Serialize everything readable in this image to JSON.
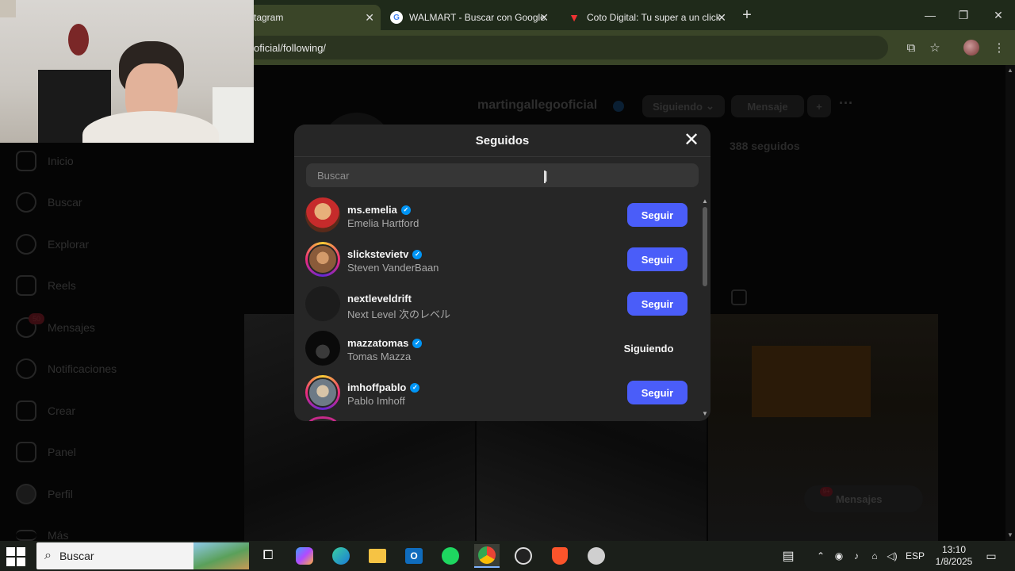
{
  "browser": {
    "tabs": [
      {
        "title": "tagram",
        "active": true,
        "favicon": "instagram-icon"
      },
      {
        "title": "WALMART - Buscar con Google",
        "active": false,
        "favicon": "google-icon"
      },
      {
        "title": "Coto Digital: Tu super a un click",
        "active": false,
        "favicon": "coto-icon"
      }
    ],
    "new_tab": "+",
    "url": "oficial/following/"
  },
  "sidebar": {
    "items": [
      {
        "label": "Inicio",
        "icon": "home-icon"
      },
      {
        "label": "Buscar",
        "icon": "search-icon"
      },
      {
        "label": "Explorar",
        "icon": "compass-icon"
      },
      {
        "label": "Reels",
        "icon": "reels-icon"
      },
      {
        "label": "Mensajes",
        "icon": "messenger-icon",
        "badge": "50"
      },
      {
        "label": "Notificaciones",
        "icon": "heart-icon"
      },
      {
        "label": "Crear",
        "icon": "plus-square-icon"
      },
      {
        "label": "Panel",
        "icon": "chart-icon"
      },
      {
        "label": "Perfil",
        "icon": "profile-icon"
      },
      {
        "label": "Más",
        "icon": "menu-icon"
      }
    ]
  },
  "profile": {
    "username": "martingallegooficial",
    "following_button": "Siguiendo",
    "message_button": "Mensaje",
    "following_count": "388 seguidos",
    "messages_pill": "Mensajes",
    "messages_badge": "9+"
  },
  "modal": {
    "title": "Seguidos",
    "search_placeholder": "Buscar",
    "users": [
      {
        "username": "ms.emelia",
        "name": "Emelia Hartford",
        "verified": true,
        "ring": false,
        "button": "Seguir",
        "following": false
      },
      {
        "username": "slickstevietv",
        "name": "Steven VanderBaan",
        "verified": true,
        "ring": true,
        "button": "Seguir",
        "following": false
      },
      {
        "username": "nextleveldrift",
        "name": "Next Level 次のレベル",
        "verified": false,
        "ring": false,
        "button": "Seguir",
        "following": false
      },
      {
        "username": "mazzatomas",
        "name": "Tomas Mazza",
        "verified": true,
        "ring": false,
        "button": "Siguiendo",
        "following": true
      },
      {
        "username": "imhoffpablo",
        "name": "Pablo Imhoff",
        "verified": true,
        "ring": true,
        "button": "Seguir",
        "following": false
      }
    ]
  },
  "taskbar": {
    "search_placeholder": "Buscar",
    "language": "ESP",
    "time": "13:10",
    "date": "1/8/2025"
  },
  "colors": {
    "follow_button": "#4a5df9",
    "verified": "#0095f6",
    "modal_bg": "#262626"
  }
}
